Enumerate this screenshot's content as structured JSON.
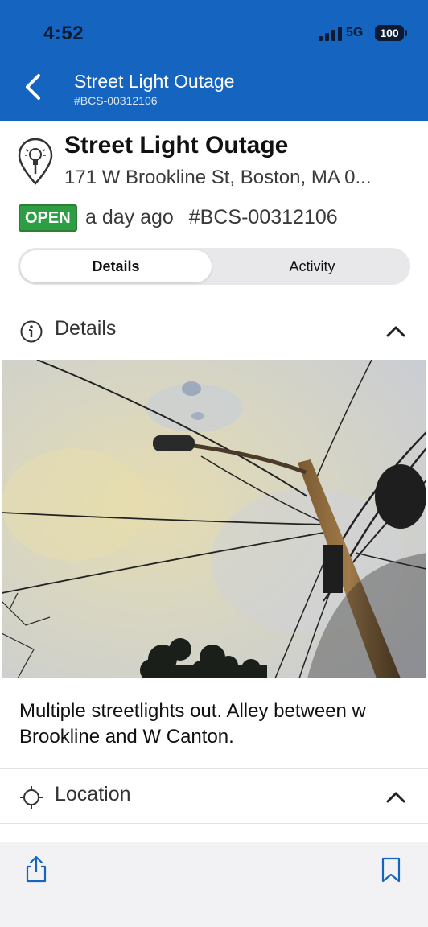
{
  "status_bar": {
    "time": "4:52",
    "network": "5G",
    "battery": "100"
  },
  "nav": {
    "title": "Street Light Outage",
    "subtitle": "#BCS-00312106"
  },
  "request": {
    "title": "Street Light Outage",
    "address": "171 W Brookline St, Boston, MA 0...",
    "status": "OPEN",
    "time_ago": "a day ago",
    "case_id": "#BCS-00312106"
  },
  "tabs": [
    {
      "label": "Details",
      "selected": true
    },
    {
      "label": "Activity",
      "selected": false
    }
  ],
  "details_section": {
    "label": "Details"
  },
  "description": "Multiple streetlights out.  Alley between w Brookline and W Canton.",
  "location_section": {
    "label": "Location"
  },
  "colors": {
    "header": "#1565c0",
    "open_badge": "#2e9e44",
    "toolbar_icon": "#1565c0"
  },
  "icons": {
    "back": "chevron-left-icon",
    "details": "info-icon",
    "location": "crosshair-icon",
    "share": "share-icon",
    "bookmark": "bookmark-icon"
  }
}
